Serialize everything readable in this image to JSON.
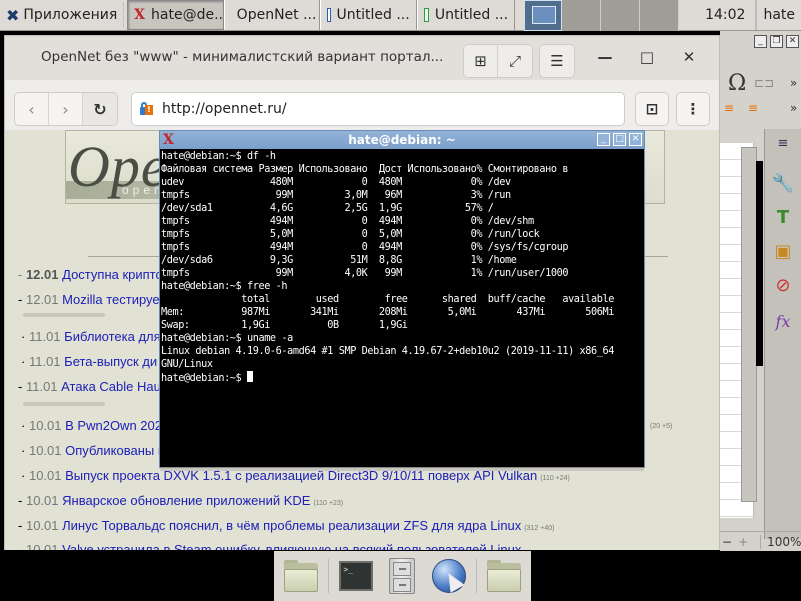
{
  "panel": {
    "apps_label": "Приложения",
    "tasks": [
      {
        "label": "hate@de...",
        "icon": "xterm-icon",
        "active": true
      },
      {
        "label": "OpenNet ...",
        "icon": "browser-leaf-icon",
        "active": false
      },
      {
        "label": "Untitled ...",
        "icon": "writer-document-icon",
        "active": false
      },
      {
        "label": "Untitled ...",
        "icon": "calc-spreadsheet-icon",
        "active": false
      }
    ],
    "workspaces": 4,
    "current_workspace": 1,
    "clock": "14:02",
    "user": "hate"
  },
  "browser": {
    "title": "OpenNet без \"www\" - минималистский вариант портал...",
    "url": "http://opennet.ru/",
    "buttons": {
      "new_tab": "⊞",
      "fullscreen": "⤢",
      "menu": "☰",
      "minimize": "—",
      "maximize": "□",
      "close": "✕",
      "back": "‹",
      "forward": "›",
      "reload": "↻",
      "bookmark": "🔖",
      "more": "⋮"
    },
    "logo": {
      "big": "Open",
      "small": "opennet"
    },
    "news": [
      {
        "bullet": "-",
        "date": "12.01",
        "title": "Доступна крипто",
        "bold_date": true,
        "count": ""
      },
      {
        "bullet": "-",
        "date": "12.01",
        "title": "Mozilla тестируе",
        "bold_date": false,
        "count": ""
      },
      {
        "bullet": "·",
        "date": "11.01",
        "title": "Библиотека для",
        "bold_date": false,
        "count": ""
      },
      {
        "bullet": "·",
        "date": "11.01",
        "title": "Бета-выпуск ди",
        "bold_date": false,
        "count": ""
      },
      {
        "bullet": "-",
        "date": "11.01",
        "title": "Атака Cable Hau",
        "bold_date": false,
        "count": ""
      },
      {
        "bullet": "·",
        "date": "10.01",
        "title": "В Pwn2Own 202",
        "bold_date": false,
        "count": ""
      },
      {
        "bullet": "·",
        "date": "10.01",
        "title": "Опубликованы и",
        "bold_date": false,
        "count": ""
      },
      {
        "bullet": "·",
        "date": "10.01",
        "title": "Выпуск проекта DXVK 1.5.1 с реализацией Direct3D 9/10/11 поверх API Vulkan",
        "bold_date": false,
        "count": "(110 +24)"
      },
      {
        "bullet": "-",
        "date": "10.01",
        "title": "Январское обновление приложений KDE",
        "bold_date": false,
        "count": "(110 +23)"
      },
      {
        "bullet": "-",
        "date": "10.01",
        "title": "Линус Торвальдс пояснил, в чём проблемы реализации ZFS для ядра Linux",
        "bold_date": false,
        "count": "(312 +40)"
      },
      {
        "bullet": "-",
        "date": "10.01",
        "title": "Valve устранила в Steam ошибку, влияющую на всякий пользователей Linux",
        "bold_date": false,
        "count": ""
      }
    ],
    "side_count": "(20 +5)"
  },
  "terminal": {
    "title": "hate@debian: ~",
    "lines": [
      "hate@debian:~$ df -h",
      "Файловая система Размер Использовано  Дост Использовано% Смонтировано в",
      "udev               480M            0  480M            0% /dev",
      "tmpfs               99M         3,0M   96M            3% /run",
      "/dev/sda1          4,6G         2,5G  1,9G           57% /",
      "tmpfs              494M            0  494M            0% /dev/shm",
      "tmpfs              5,0M            0  5,0M            0% /run/lock",
      "tmpfs              494M            0  494M            0% /sys/fs/cgroup",
      "/dev/sda6          9,3G          51M  8,8G            1% /home",
      "tmpfs               99M         4,0K   99M            1% /run/user/1000",
      "hate@debian:~$ free -h",
      "              total        used        free      shared  buff/cache   available",
      "Mem:          987Mi       341Mi       208Mi       5,0Mi       437Mi       506Mi",
      "Swap:         1,9Gi          0B       1,9Gi",
      "hate@debian:~$ uname -a",
      "Linux debian 4.19.0-6-amd64 #1 SMP Debian 4.19.67-2+deb10u2 (2019-11-11) x86_64",
      "GNU/Linux"
    ],
    "prompt": "hate@debian:~$ "
  },
  "libreoffice": {
    "more_label": "»",
    "zoom_minus": "−",
    "zoom_plus": "+",
    "zoom": "100%"
  },
  "dock": {
    "items": [
      "folder-icon",
      "terminal-icon",
      "file-cabinet-icon",
      "web-browser-icon",
      "folder-icon"
    ]
  }
}
